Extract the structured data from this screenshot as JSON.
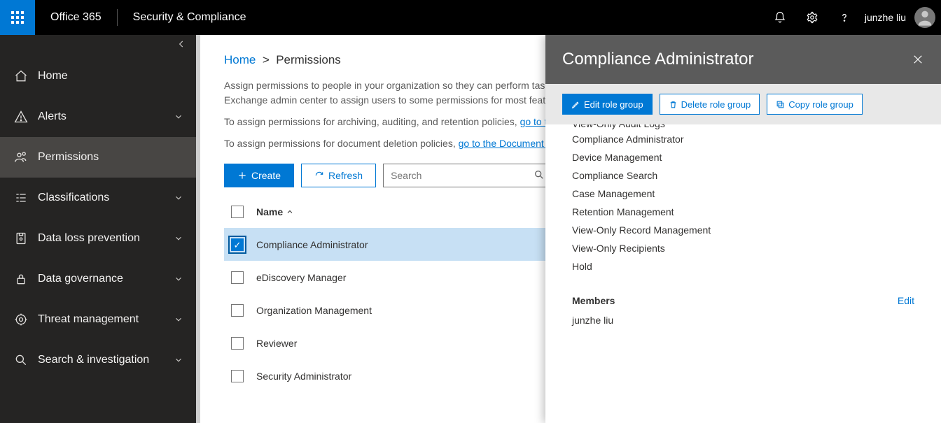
{
  "header": {
    "brand": "Office 365",
    "app": "Security & Compliance",
    "user": "junzhe liu"
  },
  "sidebar": {
    "items": [
      {
        "label": "Home",
        "icon": "home-icon",
        "expandable": false
      },
      {
        "label": "Alerts",
        "icon": "alert-icon",
        "expandable": true
      },
      {
        "label": "Permissions",
        "icon": "permissions-icon",
        "expandable": false,
        "active": true
      },
      {
        "label": "Classifications",
        "icon": "classifications-icon",
        "expandable": true
      },
      {
        "label": "Data loss prevention",
        "icon": "dlp-icon",
        "expandable": true
      },
      {
        "label": "Data governance",
        "icon": "governance-icon",
        "expandable": true
      },
      {
        "label": "Threat management",
        "icon": "threat-icon",
        "expandable": true
      },
      {
        "label": "Search & investigation",
        "icon": "search-inv-icon",
        "expandable": true
      }
    ]
  },
  "breadcrumb": {
    "root": "Home",
    "sep": ">",
    "current": "Permissions"
  },
  "descriptions": {
    "line1": "Assign permissions to people in your organization so they can perform tasks in the Security & Compliance Center. Although you can use the Exchange admin center to assign users to some permissions for most features in here, you'll need to use the Exchange admin center.",
    "line2_pre": "To assign permissions for archiving, auditing, and retention policies, ",
    "line2_link": "go to the Exchange admin center.",
    "line3_pre": "To assign permissions for document deletion policies, ",
    "line3_link": "go to the Document Deletion Policy Center."
  },
  "toolbar": {
    "create": "Create",
    "refresh": "Refresh",
    "search_placeholder": "Search"
  },
  "table": {
    "column": "Name",
    "rows": [
      {
        "name": "Compliance Administrator",
        "selected": true
      },
      {
        "name": "eDiscovery Manager",
        "selected": false
      },
      {
        "name": "Organization Management",
        "selected": false
      },
      {
        "name": "Reviewer",
        "selected": false
      },
      {
        "name": "Security Administrator",
        "selected": false
      }
    ]
  },
  "panel": {
    "title": "Compliance Administrator",
    "actions": {
      "edit": "Edit role group",
      "delete": "Delete role group",
      "copy": "Copy role group"
    },
    "roles": [
      "View-Only Audit Logs",
      "Compliance Administrator",
      "Device Management",
      "Compliance Search",
      "Case Management",
      "Retention Management",
      "View-Only Record Management",
      "View-Only Recipients",
      "Hold"
    ],
    "members_label": "Members",
    "edit_link": "Edit",
    "members": [
      "junzhe liu"
    ]
  }
}
